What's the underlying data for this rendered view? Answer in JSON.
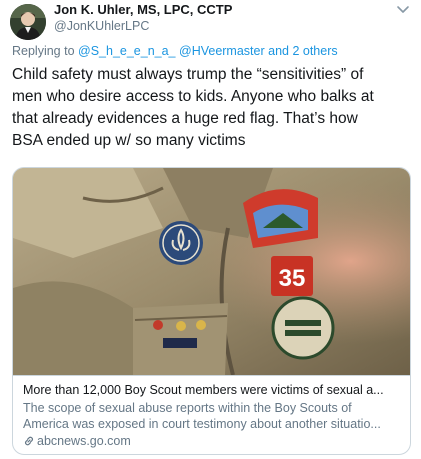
{
  "author": {
    "name": "Jon K. Uhler, MS, LPC, CCTP",
    "handle": "@JonKUhlerLPC"
  },
  "reply": {
    "prefix": "Replying to ",
    "mention1": "@S_h_e_e_n_a_",
    "mention2": "@HVeermaster",
    "suffix": "and 2 others"
  },
  "tweet": {
    "lines": [
      "Child safety must always trump the “sensitivities” of",
      "men who desire access to kids. Anyone who balks at",
      "that already evidences a huge red flag. That’s how",
      "BSA ended up w/ so many victims"
    ]
  },
  "card": {
    "title": "More than 12,000 Boy Scout members were victims of sexual a...",
    "desc_line1": "The scope of sexual abuse reports within the Boy Scouts of",
    "desc_line2": "America was exposed in court testimony about another situatio...",
    "domain": "abcnews.go.com",
    "image_patch_text": "35"
  },
  "icons": {
    "avatar": "user-avatar",
    "caret": "chevron-down-icon",
    "link": "link-icon"
  }
}
